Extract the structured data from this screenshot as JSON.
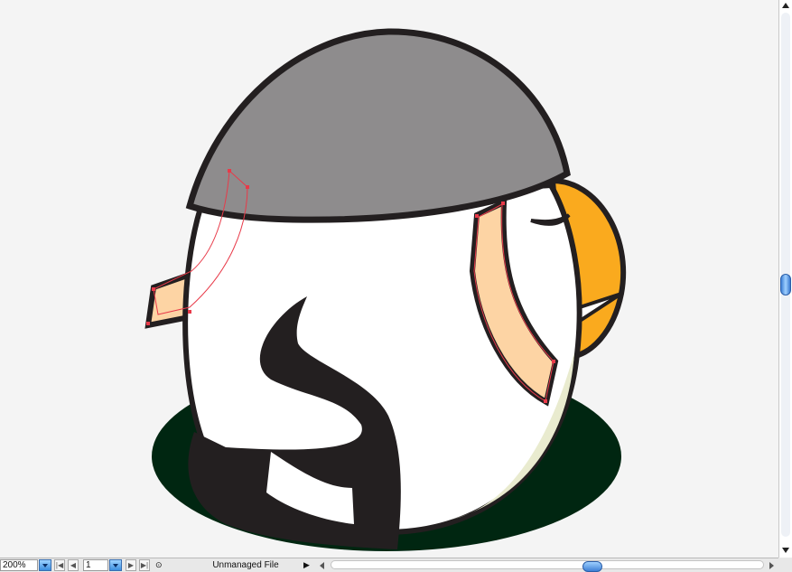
{
  "document": {
    "zoom": "200%",
    "page": "1",
    "status": "Unmanaged File"
  },
  "icons": {
    "first_page": "first-page-icon",
    "prev_page": "prev-page-icon",
    "next_page": "next-page-icon",
    "last_page": "last-page-icon",
    "status_menu": "triangle-right-icon"
  },
  "colors": {
    "canvas": "#f4f4f4",
    "helmet": "#8e8c8d",
    "outline": "#231f20",
    "body": "#ffffff",
    "shadow": "#002611",
    "beak": "#faaa1e",
    "beak_highlight": "#fcef96",
    "arm": "#fdd4a4",
    "belly_tint": "#e9ebcf",
    "selection": "#e83a49"
  },
  "scroll": {
    "vertical_position": 0.5,
    "horizontal_position": 0.6
  }
}
